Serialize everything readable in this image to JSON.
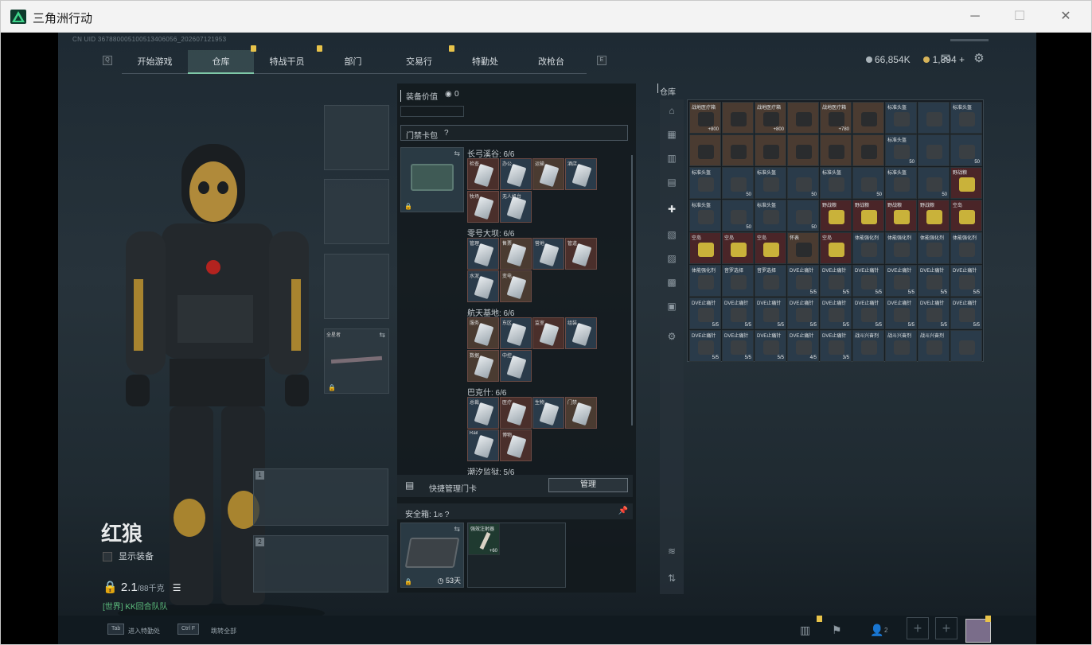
{
  "window": {
    "title": "三角洲行动"
  },
  "uid": "CN UID 367880005100513406056_202607121953",
  "nav": {
    "left_key": "Q",
    "right_key": "E",
    "tabs": [
      "开始游戏",
      "仓库",
      "特战干员",
      "部门",
      "交易行",
      "特勤处",
      "改枪台"
    ],
    "active": "仓库"
  },
  "currency": {
    "coins": "66,854K",
    "premium": "1,894 +"
  },
  "character": {
    "name": "红狼",
    "show_equipment": "显示装备",
    "kd": "2.1",
    "kd_suffix": "/88千克",
    "world": "[世界] KK回合队队"
  },
  "weapon_slots": [
    "1",
    "2"
  ],
  "rig_label": "全星者",
  "mid": {
    "equip_value_label": "装备价值",
    "equip_value": "0",
    "keycard_title": "门禁卡包",
    "help": "?",
    "categories": [
      {
        "name": "长弓溪谷: 6/6",
        "cards": [
          "检查",
          "办公",
          "运输",
          "酒店",
          "牧场",
          "无人机台"
        ]
      },
      {
        "name": "零号大坝: 6/6",
        "cards": [
          "管理",
          "售票",
          "营地",
          "管道",
          "水泥",
          "变电"
        ]
      },
      {
        "name": "航天基地: 6/6",
        "cards": [
          "服务",
          "东区",
          "监室",
          "组装",
          "数据",
          "中控"
        ]
      },
      {
        "name": "巴克什: 6/6",
        "cards": [
          "总裁",
          "医疗",
          "生物",
          "门禁",
          "Rail",
          "博物"
        ]
      }
    ],
    "partial_category": "潮汐监狱: 5/6",
    "quick_manage": "快捷管理门卡",
    "manage_btn": "管理",
    "safe_box_label": "安全箱: 1",
    "safe_box_suffix": "/6",
    "safe_box_item": "强效注射器",
    "safe_box_item_count": "+60",
    "safe_box_timer": "53天"
  },
  "stash": {
    "title": "仓库",
    "rows": [
      [
        {
          "n": "战地医疗箱",
          "c": "+800",
          "t": "brown"
        },
        {
          "n": "",
          "c": "",
          "t": "brown"
        },
        {
          "n": "战地医疗箱",
          "c": "+800",
          "t": "brown"
        },
        {
          "n": "",
          "c": "",
          "t": "brown"
        },
        {
          "n": "战地医疗箱",
          "c": "+780",
          "t": "brown"
        },
        {
          "n": "",
          "c": "",
          "t": "brown"
        },
        {
          "n": "标准头盔",
          "c": "",
          "t": "blue"
        },
        {
          "n": "",
          "c": "",
          "t": "blue"
        },
        {
          "n": "标准头盔",
          "c": "",
          "t": "blue"
        }
      ],
      [
        {
          "n": "",
          "c": "",
          "t": "brown"
        },
        {
          "n": "",
          "c": "",
          "t": "brown"
        },
        {
          "n": "",
          "c": "",
          "t": "brown"
        },
        {
          "n": "",
          "c": "",
          "t": "brown"
        },
        {
          "n": "",
          "c": "",
          "t": "brown"
        },
        {
          "n": "",
          "c": "",
          "t": "brown"
        },
        {
          "n": "标准头盔",
          "c": "50",
          "t": "blue"
        },
        {
          "n": "",
          "c": "",
          "t": "blue"
        },
        {
          "n": "",
          "c": "50",
          "t": "blue"
        }
      ],
      [
        {
          "n": "标准头盔",
          "c": "",
          "t": "blue"
        },
        {
          "n": "",
          "c": "50",
          "t": "blue"
        },
        {
          "n": "标准头盔",
          "c": "",
          "t": "blue"
        },
        {
          "n": "",
          "c": "50",
          "t": "blue"
        },
        {
          "n": "标准头盔",
          "c": "",
          "t": "blue"
        },
        {
          "n": "",
          "c": "50",
          "t": "blue"
        },
        {
          "n": "标准头盔",
          "c": "",
          "t": "blue"
        },
        {
          "n": "",
          "c": "50",
          "t": "blue"
        },
        {
          "n": "野战粮",
          "c": "",
          "t": "red"
        }
      ],
      [
        {
          "n": "标准头盔",
          "c": "",
          "t": "blue"
        },
        {
          "n": "",
          "c": "50",
          "t": "blue"
        },
        {
          "n": "标准头盔",
          "c": "",
          "t": "blue"
        },
        {
          "n": "",
          "c": "50",
          "t": "blue"
        },
        {
          "n": "野战粮",
          "c": "",
          "t": "red"
        },
        {
          "n": "野战粮",
          "c": "",
          "t": "red"
        },
        {
          "n": "野战粮",
          "c": "",
          "t": "red"
        },
        {
          "n": "野战粮",
          "c": "",
          "t": "red"
        },
        {
          "n": "空岛",
          "c": "",
          "t": "red"
        }
      ],
      [
        {
          "n": "空岛",
          "c": "",
          "t": "red"
        },
        {
          "n": "空岛",
          "c": "",
          "t": "red"
        },
        {
          "n": "空岛",
          "c": "",
          "t": "red"
        },
        {
          "n": "怀表",
          "c": "",
          "t": "brown"
        },
        {
          "n": "空岛",
          "c": "",
          "t": "red"
        },
        {
          "n": "体能强化剂",
          "c": "",
          "t": "blue"
        },
        {
          "n": "体能强化剂",
          "c": "",
          "t": "blue"
        },
        {
          "n": "体能强化剂",
          "c": "",
          "t": "blue"
        },
        {
          "n": "体能强化剂",
          "c": "",
          "t": "blue"
        }
      ],
      [
        {
          "n": "体能强化剂",
          "c": "",
          "t": "blue"
        },
        {
          "n": "音罗选择",
          "c": "",
          "t": "blue"
        },
        {
          "n": "音罗选择",
          "c": "",
          "t": "blue"
        },
        {
          "n": "DVE止痛针",
          "c": "5/5",
          "t": "blue"
        },
        {
          "n": "DVE止痛针",
          "c": "5/5",
          "t": "blue"
        },
        {
          "n": "DVE止痛针",
          "c": "5/5",
          "t": "blue"
        },
        {
          "n": "DVE止痛针",
          "c": "5/5",
          "t": "blue"
        },
        {
          "n": "DVE止痛针",
          "c": "5/5",
          "t": "blue"
        },
        {
          "n": "DVE止痛针",
          "c": "5/5",
          "t": "blue"
        }
      ],
      [
        {
          "n": "DVE止痛针",
          "c": "5/5",
          "t": "blue"
        },
        {
          "n": "DVE止痛针",
          "c": "5/5",
          "t": "blue"
        },
        {
          "n": "DVE止痛针",
          "c": "5/5",
          "t": "blue"
        },
        {
          "n": "DVE止痛针",
          "c": "5/5",
          "t": "blue"
        },
        {
          "n": "DVE止痛针",
          "c": "5/5",
          "t": "blue"
        },
        {
          "n": "DVE止痛针",
          "c": "5/5",
          "t": "blue"
        },
        {
          "n": "DVE止痛针",
          "c": "5/5",
          "t": "blue"
        },
        {
          "n": "DVE止痛针",
          "c": "5/5",
          "t": "blue"
        },
        {
          "n": "DVE止痛针",
          "c": "5/5",
          "t": "blue"
        }
      ],
      [
        {
          "n": "DVE止痛针",
          "c": "5/5",
          "t": "blue"
        },
        {
          "n": "DVE止痛针",
          "c": "5/5",
          "t": "blue"
        },
        {
          "n": "DVE止痛针",
          "c": "5/5",
          "t": "blue"
        },
        {
          "n": "DVE止痛针",
          "c": "4/5",
          "t": "blue"
        },
        {
          "n": "DVE止痛针",
          "c": "3/5",
          "t": "blue"
        },
        {
          "n": "战斗兴奋剂",
          "c": "",
          "t": "blue"
        },
        {
          "n": "战斗兴奋剂",
          "c": "",
          "t": "blue"
        },
        {
          "n": "战斗兴奋剂",
          "c": "",
          "t": "blue"
        },
        {
          "n": "",
          "c": "",
          "t": "blue"
        }
      ]
    ]
  },
  "bottom": {
    "tab_key": "Tab",
    "tab_label": "进入特勤处",
    "ctrl_key": "Ctrl F",
    "ctrl_label": "跳转全部",
    "friends": "2"
  }
}
